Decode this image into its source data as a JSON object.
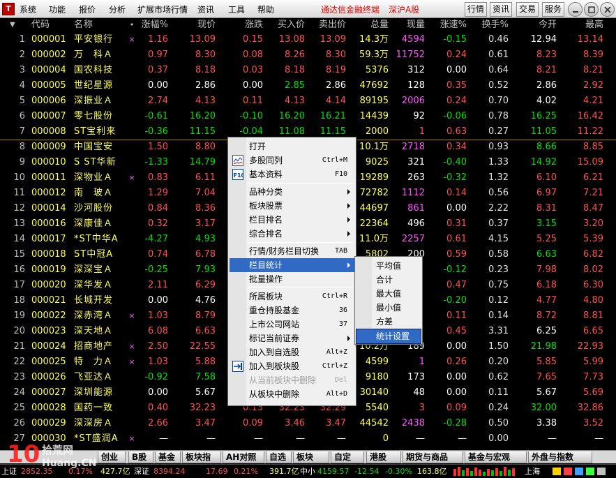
{
  "menubar": {
    "items": [
      "系统",
      "功能",
      "报价",
      "分析",
      "扩展市场行情",
      "资讯",
      "工具",
      "帮助"
    ],
    "brand": "通达信金融终端",
    "market": "深沪A股",
    "buttons": [
      "行情",
      "资讯",
      "交易",
      "服务"
    ]
  },
  "grid": {
    "headers": {
      "num": "",
      "code": "代码",
      "name": "名称",
      "dot": "•",
      "pct": "涨幅%",
      "price": "现价",
      "chg": "涨跌",
      "bid": "买入价",
      "ask": "卖出价",
      "vol": "总量",
      "cur": "现量",
      "speed": "涨速%",
      "turnover": "换手%",
      "open": "今开",
      "high": "最高"
    },
    "rows": [
      {
        "num": "1",
        "code": "000001",
        "name": "平安银行",
        "flag": "×",
        "pct": "1.16",
        "price": "13.09",
        "chg": "0.15",
        "bid": "13.08",
        "ask": "13.09",
        "vol": "14.3万",
        "cur": "4594",
        "speed": "-0.15",
        "turn": "0.46",
        "open": "12.94",
        "high": "13.14",
        "t": "up",
        "cc": "pink",
        "sc": "dn",
        "oc": "wht",
        "hc": "up"
      },
      {
        "num": "2",
        "code": "000002",
        "name": "万　科Ａ",
        "flag": "",
        "pct": "0.97",
        "price": "8.30",
        "chg": "0.08",
        "bid": "8.26",
        "ask": "8.30",
        "vol": "59.3万",
        "cur": "11752",
        "speed": "0.24",
        "turn": "0.61",
        "open": "8.23",
        "high": "8.39",
        "t": "up",
        "cc": "pink",
        "sc": "up",
        "oc": "up",
        "hc": "up"
      },
      {
        "num": "3",
        "code": "000004",
        "name": "国农科技",
        "flag": "",
        "pct": "0.37",
        "price": "8.18",
        "chg": "0.03",
        "bid": "8.18",
        "ask": "8.19",
        "vol": "5376",
        "cur": "312",
        "speed": "0.00",
        "turn": "0.64",
        "open": "8.21",
        "high": "8.21",
        "t": "up",
        "cc": "wht",
        "sc": "wht",
        "oc": "up",
        "hc": "up"
      },
      {
        "num": "4",
        "code": "000005",
        "name": "世纪星源",
        "flag": "",
        "pct": "0.00",
        "price": "2.86",
        "chg": "0.00",
        "bid": "2.85",
        "ask": "2.86",
        "vol": "47692",
        "cur": "128",
        "speed": "0.35",
        "turn": "0.52",
        "open": "2.86",
        "high": "2.92",
        "t": "eq",
        "cc": "wht",
        "sc": "up",
        "oc": "wht",
        "hc": "up",
        "bidc": "dn"
      },
      {
        "num": "5",
        "code": "000006",
        "name": "深振业Ａ",
        "flag": "",
        "pct": "2.74",
        "price": "4.13",
        "chg": "0.11",
        "bid": "4.13",
        "ask": "4.14",
        "vol": "89195",
        "cur": "2006",
        "speed": "0.24",
        "turn": "0.70",
        "open": "4.02",
        "high": "4.21",
        "t": "up",
        "cc": "pink",
        "sc": "up",
        "oc": "wht",
        "hc": "up"
      },
      {
        "num": "6",
        "code": "000007",
        "name": "零七股份",
        "flag": "",
        "pct": "-0.61",
        "price": "16.20",
        "chg": "-0.10",
        "bid": "16.20",
        "ask": "16.21",
        "vol": "14439",
        "cur": "92",
        "speed": "-0.06",
        "turn": "0.78",
        "open": "16.25",
        "high": "16.42",
        "t": "dn",
        "cc": "wht",
        "sc": "dn",
        "oc": "dn",
        "hc": "up"
      },
      {
        "num": "7",
        "code": "000008",
        "name": "ST宝利来",
        "flag": "",
        "pct": "-0.36",
        "price": "11.15",
        "chg": "-0.04",
        "bid": "11.08",
        "ask": "11.15",
        "vol": "2000",
        "cur": "1",
        "speed": "0.63",
        "turn": "0.27",
        "open": "11.05",
        "high": "11.22",
        "t": "dn",
        "cc": "up",
        "sc": "up",
        "oc": "dn",
        "hc": "up"
      },
      {
        "num": "8",
        "code": "000009",
        "name": "中国宝安",
        "flag": "",
        "pct": "1.50",
        "price": "8.80",
        "chg": "",
        "bid": "",
        "ask": "",
        "vol": "10.1万",
        "cur": "2718",
        "speed": "0.34",
        "turn": "0.93",
        "open": "8.66",
        "high": "8.85",
        "t": "up",
        "cc": "pink",
        "sc": "up",
        "oc": "dn",
        "hc": "up"
      },
      {
        "num": "9",
        "code": "000010",
        "name": "S ST华新",
        "flag": "",
        "pct": "-1.33",
        "price": "14.79",
        "chg": "",
        "bid": "",
        "ask": "",
        "vol": "9025",
        "cur": "321",
        "speed": "-0.40",
        "turn": "1.33",
        "open": "14.92",
        "high": "15.09",
        "t": "dn",
        "cc": "wht",
        "sc": "dn",
        "oc": "dn",
        "hc": "up"
      },
      {
        "num": "10",
        "code": "000011",
        "name": "深物业Ａ",
        "flag": "×",
        "pct": "0.83",
        "price": "6.11",
        "chg": "",
        "bid": "",
        "ask": "",
        "vol": "19289",
        "cur": "263",
        "speed": "-0.32",
        "turn": "1.32",
        "open": "6.10",
        "high": "6.21",
        "t": "up",
        "cc": "wht",
        "sc": "dn",
        "oc": "up",
        "hc": "up"
      },
      {
        "num": "11",
        "code": "000012",
        "name": "南　玻Ａ",
        "flag": "",
        "pct": "1.29",
        "price": "7.04",
        "chg": "",
        "bid": "",
        "ask": "",
        "vol": "72782",
        "cur": "1112",
        "speed": "0.14",
        "turn": "0.56",
        "open": "6.97",
        "high": "7.21",
        "t": "up",
        "cc": "pink",
        "sc": "up",
        "oc": "up",
        "hc": "up"
      },
      {
        "num": "12",
        "code": "000014",
        "name": "沙河股份",
        "flag": "",
        "pct": "0.84",
        "price": "8.36",
        "chg": "",
        "bid": "",
        "ask": "",
        "vol": "44697",
        "cur": "861",
        "speed": "0.00",
        "turn": "2.22",
        "open": "8.31",
        "high": "8.47",
        "t": "up",
        "cc": "pink",
        "sc": "wht",
        "oc": "up",
        "hc": "up"
      },
      {
        "num": "13",
        "code": "000016",
        "name": "深康佳Ａ",
        "flag": "",
        "pct": "0.32",
        "price": "3.17",
        "chg": "",
        "bid": "",
        "ask": "",
        "vol": "22364",
        "cur": "496",
        "speed": "0.31",
        "turn": "0.37",
        "open": "3.15",
        "high": "3.20",
        "t": "up",
        "cc": "wht",
        "sc": "up",
        "oc": "dn",
        "hc": "up"
      },
      {
        "num": "14",
        "code": "000017",
        "name": "*ST中华A",
        "flag": "",
        "pct": "-4.27",
        "price": "4.93",
        "chg": "",
        "bid": "",
        "ask": "",
        "vol": "11.0万",
        "cur": "2257",
        "speed": "0.61",
        "turn": "4.15",
        "open": "5.25",
        "high": "5.39",
        "t": "dn",
        "cc": "pink",
        "sc": "up",
        "oc": "up",
        "hc": "up"
      },
      {
        "num": "15",
        "code": "000018",
        "name": "ST中冠A",
        "flag": "",
        "pct": "0.74",
        "price": "6.78",
        "chg": "",
        "bid": "",
        "ask": "",
        "vol": "5802",
        "cur": "200",
        "speed": "0.59",
        "turn": "0.58",
        "open": "6.63",
        "high": "6.82",
        "t": "up",
        "cc": "wht",
        "sc": "up",
        "oc": "dn",
        "hc": "up"
      },
      {
        "num": "16",
        "code": "000019",
        "name": "深深宝Ａ",
        "flag": "",
        "pct": "-0.25",
        "price": "7.93",
        "chg": "",
        "bid": "",
        "ask": "",
        "vol": "",
        "cur": "",
        "speed": "-0.12",
        "turn": "0.23",
        "open": "7.98",
        "high": "8.02",
        "t": "dn",
        "cc": "wht",
        "sc": "dn",
        "oc": "up",
        "hc": "up"
      },
      {
        "num": "17",
        "code": "000020",
        "name": "深华发Ａ",
        "flag": "",
        "pct": "2.11",
        "price": "6.29",
        "chg": "",
        "bid": "",
        "ask": "",
        "vol": "",
        "cur": "",
        "speed": "0.47",
        "turn": "0.75",
        "open": "6.18",
        "high": "6.30",
        "t": "up",
        "cc": "wht",
        "sc": "up",
        "oc": "up",
        "hc": "up"
      },
      {
        "num": "18",
        "code": "000021",
        "name": "长城开发",
        "flag": "",
        "pct": "0.00",
        "price": "4.76",
        "chg": "",
        "bid": "",
        "ask": "",
        "vol": "",
        "cur": "",
        "speed": "-0.20",
        "turn": "0.12",
        "open": "4.77",
        "high": "4.80",
        "t": "eq",
        "cc": "wht",
        "sc": "dn",
        "oc": "up",
        "hc": "up"
      },
      {
        "num": "19",
        "code": "000022",
        "name": "深赤湾Ａ",
        "flag": "×",
        "pct": "1.03",
        "price": "8.79",
        "chg": "",
        "bid": "",
        "ask": "",
        "vol": "",
        "cur": "",
        "speed": "0.11",
        "turn": "0.14",
        "open": "8.72",
        "high": "8.81",
        "t": "up",
        "cc": "wht",
        "sc": "up",
        "oc": "up",
        "hc": "up"
      },
      {
        "num": "20",
        "code": "000023",
        "name": "深天地Ａ",
        "flag": "",
        "pct": "6.08",
        "price": "6.63",
        "chg": "",
        "bid": "",
        "ask": "",
        "vol": "",
        "cur": "",
        "speed": "0.45",
        "turn": "3.31",
        "open": "6.25",
        "high": "6.65",
        "t": "up",
        "cc": "wht",
        "sc": "up",
        "oc": "wht",
        "hc": "up"
      },
      {
        "num": "21",
        "code": "000024",
        "name": "招商地产",
        "flag": "×",
        "pct": "2.50",
        "price": "22.55",
        "chg": "",
        "bid": "",
        "ask": "",
        "vol": "10.2万",
        "cur": "189",
        "speed": "0.00",
        "turn": "1.50",
        "open": "21.98",
        "high": "22.93",
        "t": "up",
        "cc": "wht",
        "sc": "wht",
        "oc": "dn",
        "hc": "up"
      },
      {
        "num": "22",
        "code": "000025",
        "name": "特　力Ａ",
        "flag": "×",
        "pct": "1.03",
        "price": "5.88",
        "chg": "",
        "bid": "",
        "ask": "",
        "vol": "4599",
        "cur": "1",
        "speed": "0.26",
        "turn": "0.20",
        "open": "5.85",
        "high": "5.99",
        "t": "up",
        "cc": "pink",
        "sc": "up",
        "oc": "up",
        "hc": "up"
      },
      {
        "num": "23",
        "code": "000026",
        "name": "飞亚达Ａ",
        "flag": "",
        "pct": "-0.92",
        "price": "7.58",
        "chg": "",
        "bid": "",
        "ask": "",
        "vol": "9180",
        "cur": "173",
        "speed": "0.00",
        "turn": "0.62",
        "open": "7.65",
        "high": "7.73",
        "t": "dn",
        "cc": "wht",
        "sc": "wht",
        "oc": "up",
        "hc": "up"
      },
      {
        "num": "24",
        "code": "000027",
        "name": "深圳能源",
        "flag": "",
        "pct": "0.00",
        "price": "5.67",
        "chg": "",
        "bid": "",
        "ask": "",
        "vol": "30140",
        "cur": "48",
        "speed": "0.00",
        "turn": "0.11",
        "open": "5.67",
        "high": "5.69",
        "t": "eq",
        "cc": "wht",
        "sc": "wht",
        "oc": "wht",
        "hc": "up"
      },
      {
        "num": "25",
        "code": "000028",
        "name": "国药一致",
        "flag": "",
        "pct": "0.40",
        "price": "32.23",
        "chg": "0.13",
        "bid": "32.23",
        "ask": "32.29",
        "vol": "5540",
        "cur": "3",
        "speed": "0.09",
        "turn": "0.24",
        "open": "32.00",
        "high": "32.86",
        "t": "up",
        "cc": "up",
        "sc": "up",
        "oc": "dn",
        "hc": "up"
      },
      {
        "num": "26",
        "code": "000029",
        "name": "深深房Ａ",
        "flag": "",
        "pct": "2.66",
        "price": "3.47",
        "chg": "0.09",
        "bid": "3.46",
        "ask": "3.47",
        "vol": "44542",
        "cur": "2438",
        "speed": "-0.28",
        "turn": "0.50",
        "open": "3.38",
        "high": "3.52",
        "t": "up",
        "cc": "pink",
        "sc": "dn",
        "oc": "wht",
        "hc": "up"
      },
      {
        "num": "27",
        "code": "000030",
        "name": "*ST盛润A",
        "flag": "×",
        "pct": "—",
        "price": "—",
        "chg": "—",
        "bid": "—",
        "ask": "—",
        "vol": "0",
        "cur": "—",
        "speed": "—",
        "turn": "0.00",
        "open": "—",
        "high": "—",
        "t": "eq",
        "cc": "wht",
        "sc": "wht",
        "oc": "wht",
        "hc": "wht"
      }
    ]
  },
  "context_menu": {
    "items": [
      {
        "label": "打开",
        "key": "",
        "arrow": false,
        "icon": "",
        "state": "normal"
      },
      {
        "label": "多股同列",
        "key": "Ctrl+M",
        "arrow": false,
        "icon": "multi-chart-icon",
        "state": "normal"
      },
      {
        "label": "基本资料",
        "key": "F10",
        "arrow": false,
        "icon": "f10-icon",
        "state": "normal"
      },
      {
        "sep": true
      },
      {
        "label": "品种分类",
        "key": "",
        "arrow": true,
        "icon": "",
        "state": "normal"
      },
      {
        "label": "板块股票",
        "key": "",
        "arrow": true,
        "icon": "",
        "state": "normal"
      },
      {
        "label": "栏目排名",
        "key": "",
        "arrow": true,
        "icon": "",
        "state": "normal"
      },
      {
        "label": "综合排名",
        "key": "",
        "arrow": true,
        "icon": "",
        "state": "normal"
      },
      {
        "sep": true
      },
      {
        "label": "行情/财务栏目切换",
        "key": "TAB",
        "arrow": false,
        "icon": "",
        "state": "normal"
      },
      {
        "label": "栏目统计",
        "key": "",
        "arrow": true,
        "icon": "",
        "state": "active"
      },
      {
        "label": "批量操作",
        "key": "",
        "arrow": false,
        "icon": "",
        "state": "normal"
      },
      {
        "sep": true
      },
      {
        "label": "所属板块",
        "key": "Ctrl+R",
        "arrow": false,
        "icon": "",
        "state": "normal"
      },
      {
        "label": "重仓持股基金",
        "key": "36",
        "arrow": false,
        "icon": "",
        "state": "normal"
      },
      {
        "label": "上市公司网站",
        "key": "37",
        "arrow": false,
        "icon": "",
        "state": "normal"
      },
      {
        "label": "标记当前证券",
        "key": "",
        "arrow": true,
        "icon": "",
        "state": "normal"
      },
      {
        "label": "加入到自选股",
        "key": "Alt+Z",
        "arrow": false,
        "icon": "",
        "state": "normal"
      },
      {
        "label": "加入到板块股",
        "key": "Ctrl+Z",
        "arrow": false,
        "icon": "add-to-block-icon",
        "state": "normal"
      },
      {
        "label": "从当前板块中删除",
        "key": "Del",
        "arrow": false,
        "icon": "",
        "state": "disabled"
      },
      {
        "label": "从板块中删除",
        "key": "Alt+D",
        "arrow": false,
        "icon": "",
        "state": "normal"
      }
    ]
  },
  "submenu": {
    "items": [
      {
        "label": "平均值",
        "state": "normal"
      },
      {
        "label": "合计",
        "state": "normal"
      },
      {
        "label": "最大值",
        "state": "normal"
      },
      {
        "label": "最小值",
        "state": "normal"
      },
      {
        "label": "方差",
        "state": "normal"
      },
      {
        "label": "统计设置",
        "state": "active"
      }
    ]
  },
  "tabs": [
    "创业",
    "B股",
    "基金",
    "板块指数",
    "AH对照",
    "自选",
    "板块",
    "自定",
    "港股",
    "期货与商品",
    "基金与宏观",
    "外盘与指数"
  ],
  "status": {
    "sh_label": "上证",
    "sh_index": "2852.35",
    "sh_pct": "0.17%",
    "sh_amount": "427.7亿",
    "sz_label": "深证",
    "sz_index": "8394.24",
    "sz_chg": "17.69",
    "sz_pct": "0.21%",
    "sz_amount": "391.7亿",
    "zx_label": "中小",
    "zx_index": "4159.57",
    "zx_chg": "-12.54",
    "zx_pct": "-0.30%",
    "zx_amount": "163.8亿",
    "sh_short": "上海"
  },
  "watermark": {
    "text": "10",
    "sub": "拾荒网",
    "url": "Huang.CN"
  },
  "colors": {
    "up": "#ff5050",
    "down": "#00e000",
    "menu_highlight": "#316ac5",
    "code_yellow": "#ffff54"
  }
}
